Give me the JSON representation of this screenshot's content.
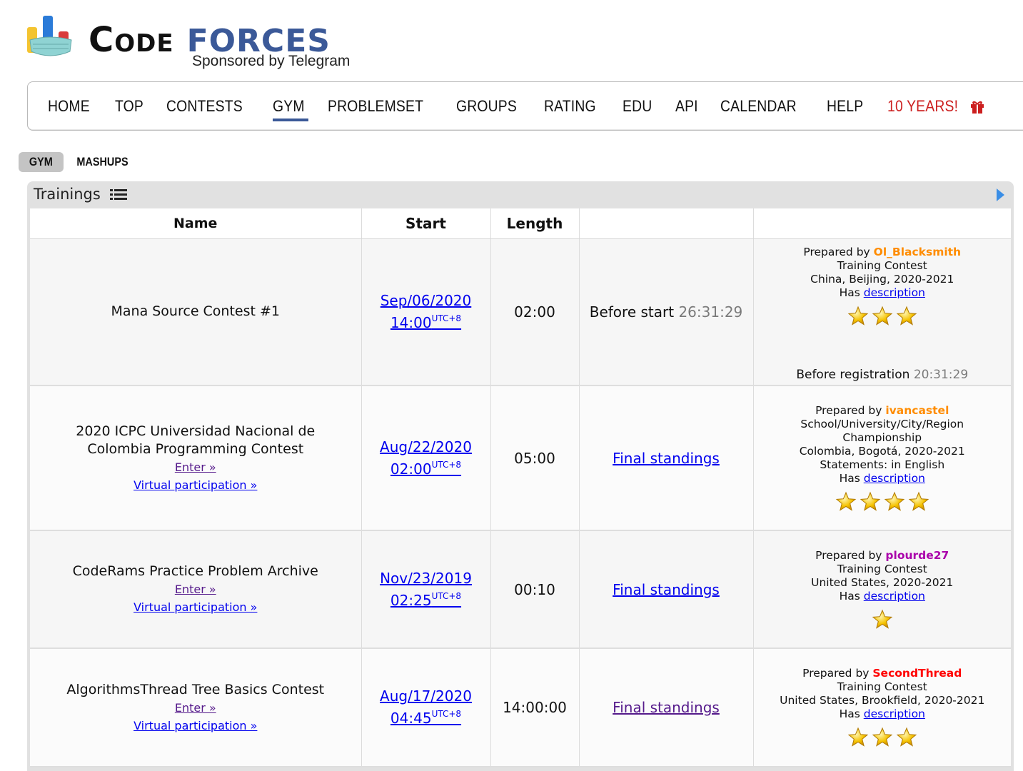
{
  "logo": {
    "code": "Code",
    "forces": "forces",
    "sponsor": "Sponsored by Telegram"
  },
  "menu": {
    "items": [
      {
        "label": "HOME"
      },
      {
        "label": "TOP"
      },
      {
        "label": "CONTESTS"
      },
      {
        "label": "GYM",
        "active": true
      },
      {
        "label": "PROBLEMSET"
      },
      {
        "label": "GROUPS"
      },
      {
        "label": "RATING"
      },
      {
        "label": "EDU"
      },
      {
        "label": "API"
      },
      {
        "label": "CALENDAR"
      },
      {
        "label": "HELP"
      },
      {
        "label": "10 YEARS!",
        "icon": "gift-icon",
        "color": "#cc1f1f"
      }
    ]
  },
  "submenu": {
    "gym": "GYM",
    "mashups": "MASHUPS"
  },
  "trainings": {
    "title": "Trainings",
    "columns": {
      "name": "Name",
      "start": "Start",
      "length": "Length",
      "state": "",
      "info": ""
    },
    "rows": [
      {
        "name_lines": [
          "Mana Source Contest #1"
        ],
        "enter": "",
        "virtual": "",
        "start_date": "Sep/06/2020",
        "start_time": "14:00",
        "tz": "UTC+8",
        "length": "02:00",
        "state_label": "Before start",
        "state_timer": "26:31:29",
        "prepared_by_label": "Prepared by",
        "author": "Ol_Blacksmith",
        "author_color": "#ff8c00",
        "type_lines": [
          "Training Contest"
        ],
        "location": "China, Beijing, 2020-2021",
        "statements": "",
        "has_label": "Has",
        "description": "description",
        "stars": 3,
        "reg_label": "Before registration",
        "reg_timer": "20:31:29"
      },
      {
        "name_lines": [
          "2020 ICPC Universidad Nacional de",
          "Colombia Programming Contest"
        ],
        "enter": "Enter »",
        "virtual": "Virtual participation »",
        "start_date": "Aug/22/2020",
        "start_time": "02:00",
        "tz": "UTC+8",
        "length": "05:00",
        "state_link": "Final standings",
        "prepared_by_label": "Prepared by",
        "author": "ivancastel",
        "author_color": "#ff8c00",
        "type_lines": [
          "School/University/City/Region",
          "Championship"
        ],
        "location": "Colombia, Bogotá, 2020-2021",
        "statements": "Statements: in English",
        "has_label": "Has",
        "description": "description",
        "stars": 4
      },
      {
        "name_lines": [
          "CodeRams Practice Problem Archive"
        ],
        "enter": "Enter »",
        "virtual": "Virtual participation »",
        "start_date": "Nov/23/2019",
        "start_time": "02:25",
        "tz": "UTC+8",
        "length": "00:10",
        "state_link": "Final standings",
        "prepared_by_label": "Prepared by",
        "author": "plourde27",
        "author_color": "#aa00aa",
        "type_lines": [
          "Training Contest"
        ],
        "location": "United States, 2020-2021",
        "statements": "",
        "has_label": "Has",
        "description": "description",
        "stars": 1
      },
      {
        "name_lines": [
          "AlgorithmsThread Tree Basics Contest"
        ],
        "enter": "Enter »",
        "virtual": "Virtual participation »",
        "start_date": "Aug/17/2020",
        "start_time": "04:45",
        "tz": "UTC+8",
        "length": "14:00:00",
        "state_link": "Final standings",
        "prepared_by_label": "Prepared by",
        "author": "SecondThread",
        "author_color": "#ff0000",
        "type_lines": [
          "Training Contest"
        ],
        "location": "United States, Brookfield, 2020-2021",
        "statements": "",
        "has_label": "Has",
        "description": "description",
        "stars": 3
      }
    ]
  }
}
